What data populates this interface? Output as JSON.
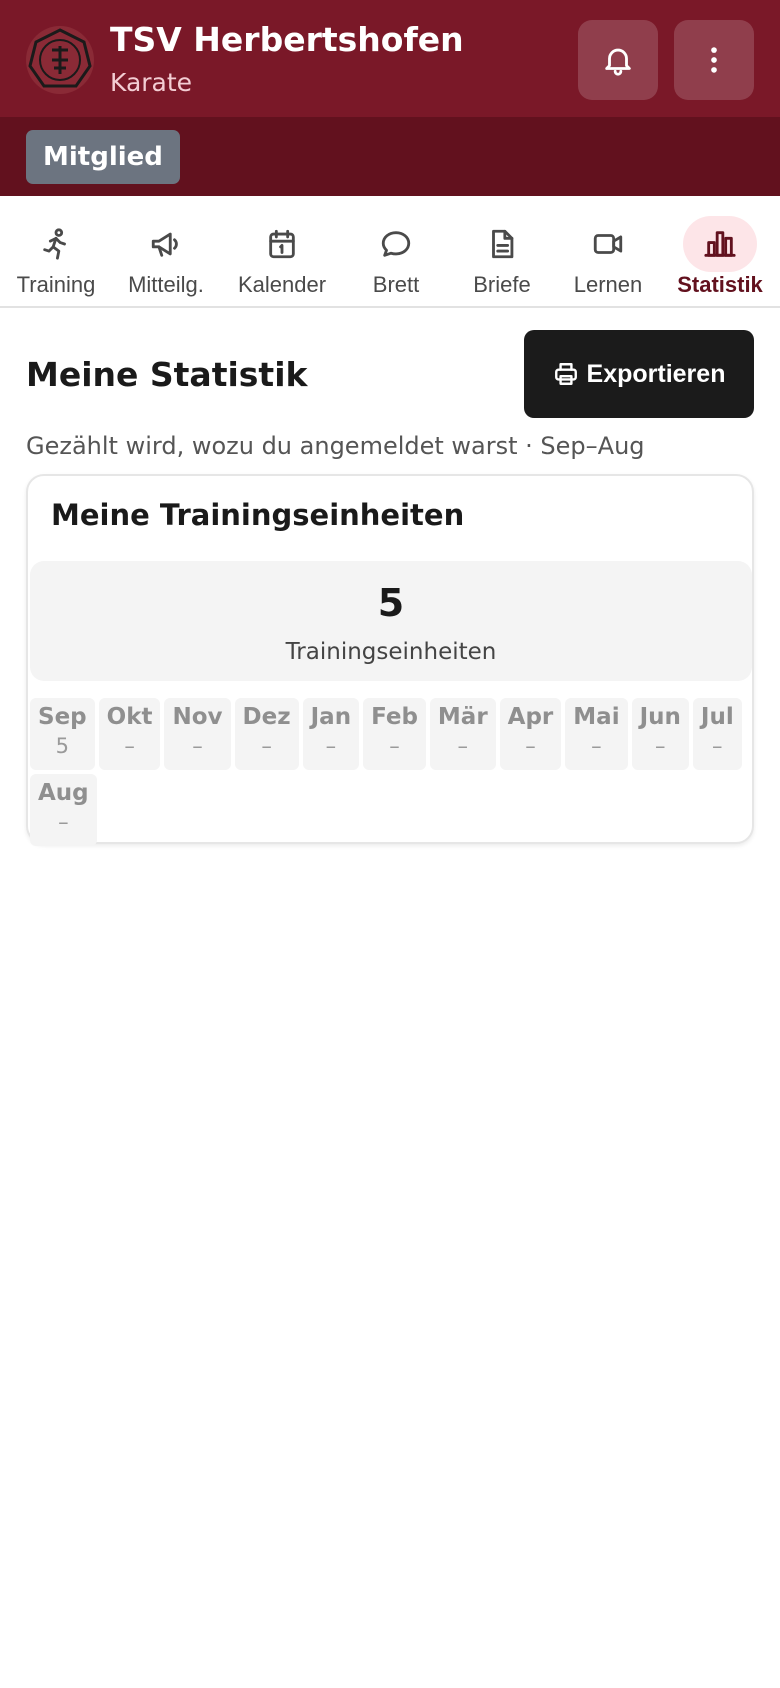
{
  "header": {
    "club_name": "TSV Herbertshofen",
    "club_sub": "Karate",
    "role_badge": "Mitglied",
    "accent": "#7a1828",
    "accent_dark": "#62111e"
  },
  "tabs": [
    {
      "label": "Training",
      "icon": "running-person-icon",
      "active": false
    },
    {
      "label": "Mitteilg.",
      "icon": "megaphone-icon",
      "active": false
    },
    {
      "label": "Kalender",
      "icon": "calendar-icon",
      "active": false
    },
    {
      "label": "Brett",
      "icon": "speech-bubble-icon",
      "active": false
    },
    {
      "label": "Briefe",
      "icon": "document-icon",
      "active": false
    },
    {
      "label": "Lernen",
      "icon": "video-camera-icon",
      "active": false
    },
    {
      "label": "Statistik",
      "icon": "bar-chart-icon",
      "active": true
    }
  ],
  "main": {
    "title": "Meine Statistik",
    "export_label": "Exportieren",
    "subtitle": "Gezählt wird, wozu du angemeldet warst · Sep–Aug",
    "card": {
      "title": "Meine Trainingseinheiten",
      "total_value": "5",
      "total_label": "Trainingseinheiten",
      "months": [
        {
          "name": "Sep",
          "value": "5"
        },
        {
          "name": "Okt",
          "value": "–"
        },
        {
          "name": "Nov",
          "value": "–"
        },
        {
          "name": "Dez",
          "value": "–"
        },
        {
          "name": "Jan",
          "value": "–"
        },
        {
          "name": "Feb",
          "value": "–"
        },
        {
          "name": "Mär",
          "value": "–"
        },
        {
          "name": "Apr",
          "value": "–"
        },
        {
          "name": "Mai",
          "value": "–"
        },
        {
          "name": "Jun",
          "value": "–"
        },
        {
          "name": "Jul",
          "value": "–"
        },
        {
          "name": "Aug",
          "value": "–"
        }
      ]
    }
  }
}
